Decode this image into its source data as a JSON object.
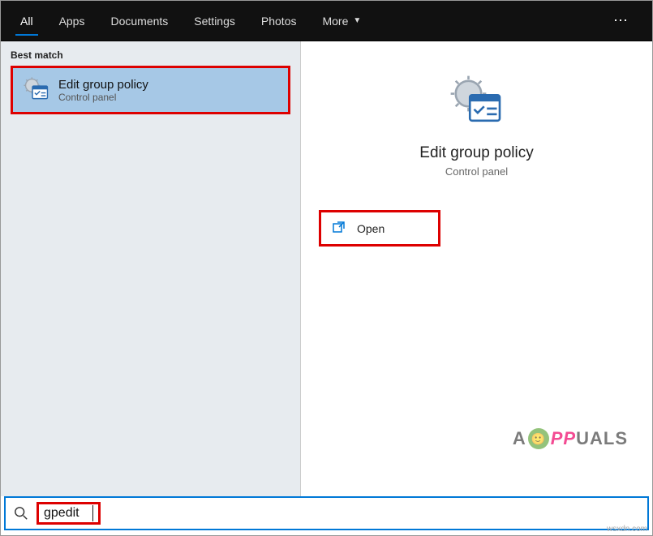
{
  "tabs": {
    "all": "All",
    "apps": "Apps",
    "documents": "Documents",
    "settings": "Settings",
    "photos": "Photos",
    "more": "More"
  },
  "left": {
    "section_label": "Best match",
    "result": {
      "title": "Edit group policy",
      "subtitle": "Control panel"
    }
  },
  "detail": {
    "title": "Edit group policy",
    "subtitle": "Control panel",
    "open_label": "Open"
  },
  "search": {
    "value": "gpedit"
  },
  "brand": {
    "prefix": "A",
    "mid": "PP",
    "suffix": "UALS"
  },
  "watermark": "wsxdn.com"
}
